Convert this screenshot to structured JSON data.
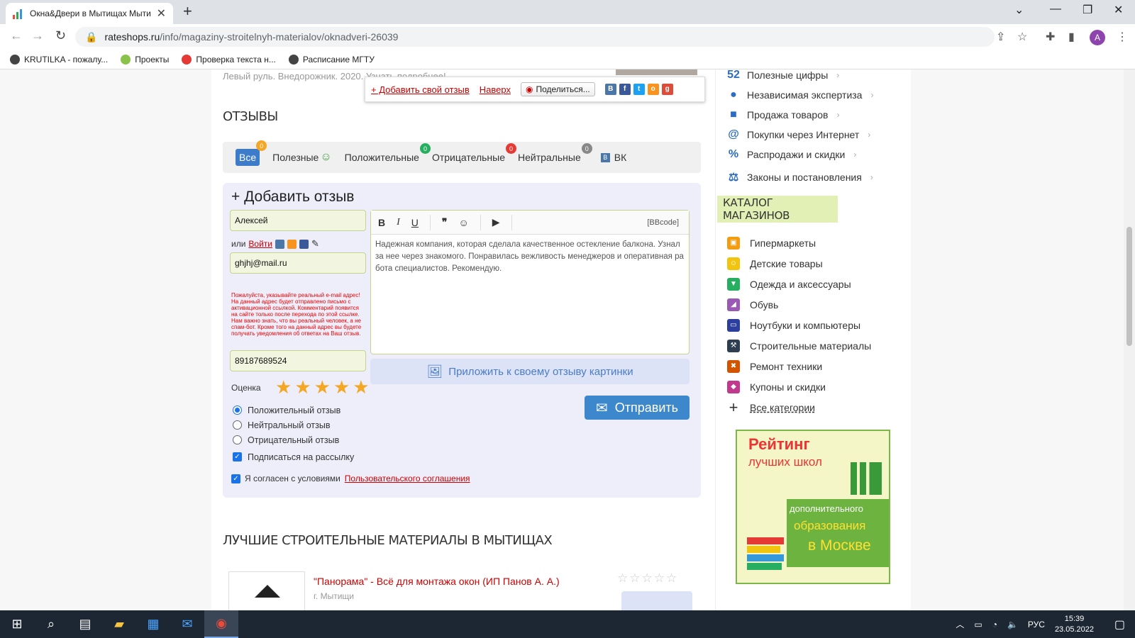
{
  "browser": {
    "tab_title": "Окна&Двери в Мытищах Мыти",
    "url_host": "rateshops.ru",
    "url_path": "/info/magaziny-stroitelnyh-materialov/oknadveri-26039",
    "profile_initial": "A",
    "bookmarks": [
      {
        "label": "KRUTILKA - пожалу...",
        "icon": "globe-icon"
      },
      {
        "label": "Проекты",
        "icon": "projects-icon"
      },
      {
        "label": "Проверка текста н...",
        "icon": "antiplagiat-icon"
      },
      {
        "label": "Расписание МГТУ",
        "icon": "globe-icon"
      }
    ]
  },
  "floating_bar": {
    "add_review": "+ Добавить свой отзыв",
    "to_top": "Наверх",
    "share": "Поделиться..."
  },
  "prev_text": "Левый руль. Внедорожник. 2020. Узнать подробнее!",
  "reviews": {
    "heading": "ОТЗЫВЫ",
    "filters": {
      "all": "Все",
      "all_count": "0",
      "useful": "Полезные",
      "positive": "Положительные",
      "positive_count": "0",
      "negative": "Отрицательные",
      "negative_count": "0",
      "neutral": "Нейтральные",
      "neutral_count": "0",
      "vk": "ВК"
    }
  },
  "form": {
    "title": "+ Добавить отзыв",
    "name_value": "Алексей",
    "or_text": "или",
    "login_link": "Войти",
    "email_value": "ghjhj@mail.ru",
    "warning": "Пожалуйста, указывайте реальный e-mail адрес! На данный адрес будет отправлено письмо с активационной ссылкой. Комментарий появится на сайте только после перехода по этой ссылке. Нам важно знать, что вы реальный человек, а не спам-бот. Кроме того на данный адрес вы будете получать уведомления об ответах на Ваш отзыв.",
    "phone_value": "89187689524",
    "rating_label": "Оценка",
    "rating": 5,
    "radio_positive": "Положительный отзыв",
    "radio_neutral": "Нейтральный отзыв",
    "radio_negative": "Отрицательный отзыв",
    "subscribe": "Подписаться на рассылку",
    "agree_text": "Я согласен с условиями",
    "agree_link": "Пользовательского соглашения",
    "bbcode": "[BBcode]",
    "review_text": "Надежная компания, которая сделала качественное остекление балкона. Узнал за нее через знакомого. Понравилась вежливость менеджеров и оперативная работа специалистов. Рекомендую.",
    "attach": "Приложить к своему отзыву картинки",
    "send": "Отправить"
  },
  "best": {
    "heading": "ЛУЧШИЕ СТРОИТЕЛЬНЫЕ МАТЕРИАЛЫ В МЫТИЩАХ",
    "shop_name": "\"Панорама\" - Всё для монтажа окон (ИП Панов А. А.)",
    "shop_city": "г. Мытищи",
    "shop_stars": "☆☆☆☆☆"
  },
  "sidebar": {
    "info_items": [
      {
        "label": "Полезные цифры",
        "icon": "numbers-icon"
      },
      {
        "label": "Независимая экспертиза",
        "icon": "person-icon"
      },
      {
        "label": "Продажа товаров",
        "icon": "bag-icon"
      },
      {
        "label": "Покупки через Интернет",
        "icon": "at-icon"
      },
      {
        "label": "Распродажи и скидки",
        "icon": "percent-icon"
      },
      {
        "label": "Законы и постановления",
        "icon": "scales-icon"
      }
    ],
    "catalog_heading": "КАТАЛОГ МАГАЗИНОВ",
    "catalog_items": [
      {
        "label": "Гипермаркеты",
        "icon": "hypermarket-icon",
        "color": "#f39c12"
      },
      {
        "label": "Детские товары",
        "icon": "kids-icon",
        "color": "#f1c40f"
      },
      {
        "label": "Одежда и аксессуары",
        "icon": "clothes-icon",
        "color": "#27ae60"
      },
      {
        "label": "Обувь",
        "icon": "shoes-icon",
        "color": "#9b59b6"
      },
      {
        "label": "Ноутбуки и компьютеры",
        "icon": "computer-icon",
        "color": "#2c3e9e"
      },
      {
        "label": "Строительные материалы",
        "icon": "tools-icon",
        "color": "#2c3e50"
      },
      {
        "label": "Ремонт техники",
        "icon": "repair-icon",
        "color": "#d35400"
      },
      {
        "label": "Купоны и скидки",
        "icon": "coupon-icon",
        "color": "#c0398c"
      }
    ],
    "all_categories": "Все категории",
    "banner": {
      "line1": "Рейтинг",
      "line2": "лучших школ",
      "line3": "дополнительного",
      "line4": "образования",
      "line5": "в Москве"
    }
  },
  "taskbar": {
    "lang": "РУС",
    "time": "15:39",
    "date": "23.05.2022"
  }
}
